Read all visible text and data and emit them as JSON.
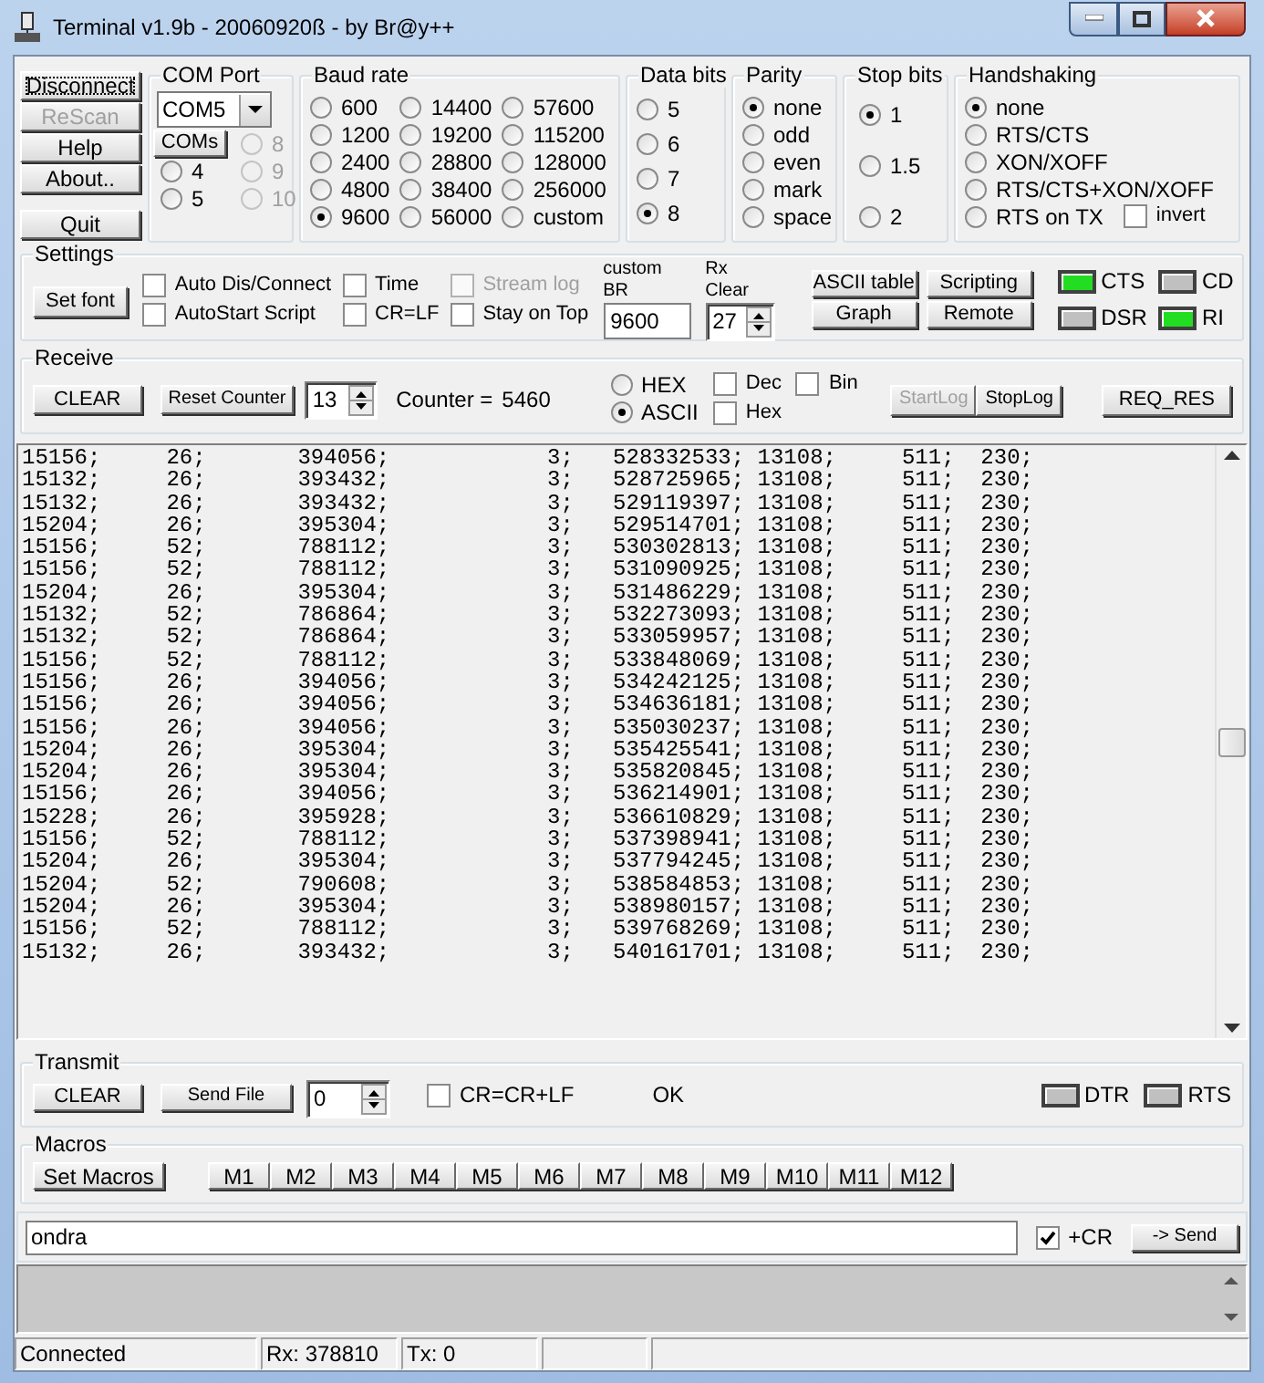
{
  "window": {
    "title": "Terminal v1.9b - 20060920ß - by Br@y++"
  },
  "side_buttons": [
    {
      "label": "Disconnect",
      "disabled": false
    },
    {
      "label": "ReScan",
      "disabled": true
    },
    {
      "label": "Help",
      "disabled": false
    },
    {
      "label": "About..",
      "disabled": false
    },
    {
      "label": "Quit",
      "disabled": false
    }
  ],
  "com_port": {
    "title": "COM Port",
    "value": "COM5",
    "button": "COMs",
    "ports": [
      {
        "label": "8",
        "disabled": true,
        "selected": false
      },
      {
        "label": "4",
        "disabled": false,
        "selected": false
      },
      {
        "label": "9",
        "disabled": true,
        "selected": false
      },
      {
        "label": "5",
        "disabled": false,
        "selected": false
      },
      {
        "label": "10",
        "disabled": true,
        "selected": false
      }
    ]
  },
  "baud_rate": {
    "title": "Baud rate",
    "options": [
      {
        "label": "600",
        "selected": false
      },
      {
        "label": "1200",
        "selected": false
      },
      {
        "label": "2400",
        "selected": false
      },
      {
        "label": "4800",
        "selected": false
      },
      {
        "label": "9600",
        "selected": true
      },
      {
        "label": "14400",
        "selected": false
      },
      {
        "label": "19200",
        "selected": false
      },
      {
        "label": "28800",
        "selected": false
      },
      {
        "label": "38400",
        "selected": false
      },
      {
        "label": "56000",
        "selected": false
      },
      {
        "label": "57600",
        "selected": false
      },
      {
        "label": "115200",
        "selected": false
      },
      {
        "label": "128000",
        "selected": false
      },
      {
        "label": "256000",
        "selected": false
      },
      {
        "label": "custom",
        "selected": false
      }
    ]
  },
  "data_bits": {
    "title": "Data bits",
    "options": [
      {
        "label": "5",
        "selected": false
      },
      {
        "label": "6",
        "selected": false
      },
      {
        "label": "7",
        "selected": false
      },
      {
        "label": "8",
        "selected": true
      }
    ]
  },
  "parity": {
    "title": "Parity",
    "options": [
      {
        "label": "none",
        "selected": true
      },
      {
        "label": "odd",
        "selected": false
      },
      {
        "label": "even",
        "selected": false
      },
      {
        "label": "mark",
        "selected": false
      },
      {
        "label": "space",
        "selected": false
      }
    ]
  },
  "stop_bits": {
    "title": "Stop bits",
    "options": [
      {
        "label": "1",
        "selected": true
      },
      {
        "label": "1.5",
        "selected": false
      },
      {
        "label": "2",
        "selected": false
      }
    ]
  },
  "handshaking": {
    "title": "Handshaking",
    "options": [
      {
        "label": "none",
        "selected": true
      },
      {
        "label": "RTS/CTS",
        "selected": false
      },
      {
        "label": "XON/XOFF",
        "selected": false
      },
      {
        "label": "RTS/CTS+XON/XOFF",
        "selected": false
      },
      {
        "label": "RTS on TX",
        "selected": false
      }
    ],
    "invert": {
      "label": "invert",
      "checked": false
    }
  },
  "settings": {
    "title": "Settings",
    "set_font": "Set font",
    "checkboxes": [
      {
        "label": "Auto Dis/Connect",
        "checked": false,
        "disabled": false
      },
      {
        "label": "AutoStart Script",
        "checked": false,
        "disabled": false
      },
      {
        "label": "Time",
        "checked": false,
        "disabled": false
      },
      {
        "label": "CR=LF",
        "checked": false,
        "disabled": false
      },
      {
        "label": "Stream log",
        "checked": false,
        "disabled": true
      },
      {
        "label": "Stay on Top",
        "checked": false,
        "disabled": false
      }
    ],
    "custom_br": {
      "label": "custom BR",
      "value": "9600"
    },
    "rx_clear": {
      "label": "Rx Clear",
      "value": "27"
    },
    "buttons": [
      "ASCII table",
      "Graph",
      "Scripting",
      "Remote"
    ],
    "indicators": [
      {
        "label": "CTS",
        "on": true
      },
      {
        "label": "DSR",
        "on": false
      },
      {
        "label": "CD",
        "on": false
      },
      {
        "label": "RI",
        "on": true
      }
    ]
  },
  "receive": {
    "title": "Receive",
    "clear": "CLEAR",
    "reset_counter": "Reset Counter",
    "spin_value": "13",
    "counter_label": "Counter =",
    "counter": "5460",
    "modes": [
      {
        "label": "HEX",
        "selected": false
      },
      {
        "label": "ASCII",
        "selected": true
      }
    ],
    "checkboxes": [
      {
        "label": "Dec",
        "checked": false
      },
      {
        "label": "Hex",
        "checked": false
      },
      {
        "label": "Bin",
        "checked": false
      }
    ],
    "log_buttons": [
      {
        "label": "StartLog",
        "disabled": true
      },
      {
        "label": "StopLog",
        "disabled": false
      }
    ],
    "req_res": "REQ_RES"
  },
  "log_lines": [
    "15156;     26;       394056;            3;   528332533; 13108;     511;  230;",
    "15132;     26;       393432;            3;   528725965; 13108;     511;  230;",
    "15132;     26;       393432;            3;   529119397; 13108;     511;  230;",
    "15204;     26;       395304;            3;   529514701; 13108;     511;  230;",
    "15156;     52;       788112;            3;   530302813; 13108;     511;  230;",
    "15156;     52;       788112;            3;   531090925; 13108;     511;  230;",
    "15204;     26;       395304;            3;   531486229; 13108;     511;  230;",
    "15132;     52;       786864;            3;   532273093; 13108;     511;  230;",
    "15132;     52;       786864;            3;   533059957; 13108;     511;  230;",
    "15156;     52;       788112;            3;   533848069; 13108;     511;  230;",
    "15156;     26;       394056;            3;   534242125; 13108;     511;  230;",
    "15156;     26;       394056;            3;   534636181; 13108;     511;  230;",
    "15156;     26;       394056;            3;   535030237; 13108;     511;  230;",
    "15204;     26;       395304;            3;   535425541; 13108;     511;  230;",
    "15204;     26;       395304;            3;   535820845; 13108;     511;  230;",
    "15156;     26;       394056;            3;   536214901; 13108;     511;  230;",
    "15228;     26;       395928;            3;   536610829; 13108;     511;  230;",
    "15156;     52;       788112;            3;   537398941; 13108;     511;  230;",
    "15204;     26;       395304;            3;   537794245; 13108;     511;  230;",
    "15204;     52;       790608;            3;   538584853; 13108;     511;  230;",
    "15204;     26;       395304;            3;   538980157; 13108;     511;  230;",
    "15156;     52;       788112;            3;   539768269; 13108;     511;  230;",
    "15132;     26;       393432;            3;   540161701; 13108;     511;  230;"
  ],
  "transmit": {
    "title": "Transmit",
    "clear": "CLEAR",
    "send_file": "Send File",
    "spin_value": "0",
    "checkbox": {
      "label": "CR=CR+LF",
      "checked": false
    },
    "status": "OK",
    "indicators": [
      {
        "label": "DTR",
        "on": false
      },
      {
        "label": "RTS",
        "on": false
      }
    ]
  },
  "macros": {
    "title": "Macros",
    "set_macros": "Set Macros",
    "buttons": [
      "M1",
      "M2",
      "M3",
      "M4",
      "M5",
      "M6",
      "M7",
      "M8",
      "M9",
      "M10",
      "M11",
      "M12"
    ]
  },
  "send": {
    "value": "ondra",
    "cr": {
      "label": "+CR",
      "checked": true
    },
    "button": "-> Send"
  },
  "status_bar": [
    "Connected",
    "Rx: 378810",
    "Tx: 0"
  ]
}
